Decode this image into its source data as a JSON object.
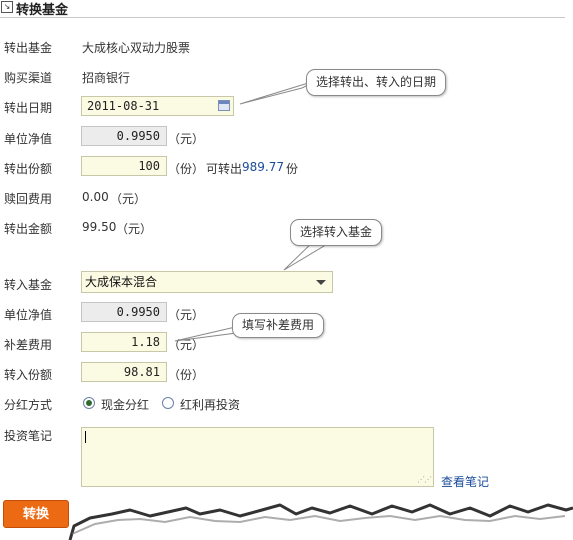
{
  "panel": {
    "title": "转换基金"
  },
  "out": {
    "fund_label": "转出基金",
    "fund_value": "大成核心双动力股票",
    "channel_label": "购买渠道",
    "channel_value": "招商银行",
    "date_label": "转出日期",
    "date_value": "2011-08-31",
    "nav_label": "单位净值",
    "nav_value": "0.9950",
    "nav_unit": "（元）",
    "shares_label": "转出份额",
    "shares_value": "100",
    "shares_unit": "（份）",
    "available_prefix": "可转出",
    "available_value": "989.77",
    "available_suffix": "份",
    "redeem_fee_label": "赎回费用",
    "redeem_fee_value": "0.00",
    "redeem_fee_unit": "（元）",
    "amount_label": "转出金额",
    "amount_value": "99.50",
    "amount_unit": "（元）"
  },
  "in": {
    "fund_label": "转入基金",
    "fund_selected": "大成保本混合",
    "nav_label": "单位净值",
    "nav_value": "0.9950",
    "nav_unit": "（元）",
    "diff_fee_label": "补差费用",
    "diff_fee_value": "1.18",
    "diff_fee_unit": "（元）",
    "shares_label": "转入份额",
    "shares_value": "98.81",
    "shares_unit": "（份）",
    "dividend_label": "分红方式",
    "dividend_options": [
      {
        "label": "现金分红",
        "selected": true
      },
      {
        "label": "红利再投资",
        "selected": false
      }
    ],
    "notes_label": "投资笔记",
    "notes_value": "",
    "view_notes_link": "查看笔记"
  },
  "callouts": {
    "date_hint": "选择转出、转入的日期",
    "fund_hint": "选择转入基金",
    "fee_hint": "填写补差费用"
  },
  "submit": {
    "label": "转换"
  },
  "colors": {
    "accent": "#ec6a14",
    "input_bg": "#fbfbe4",
    "link": "#1a4b9a"
  }
}
